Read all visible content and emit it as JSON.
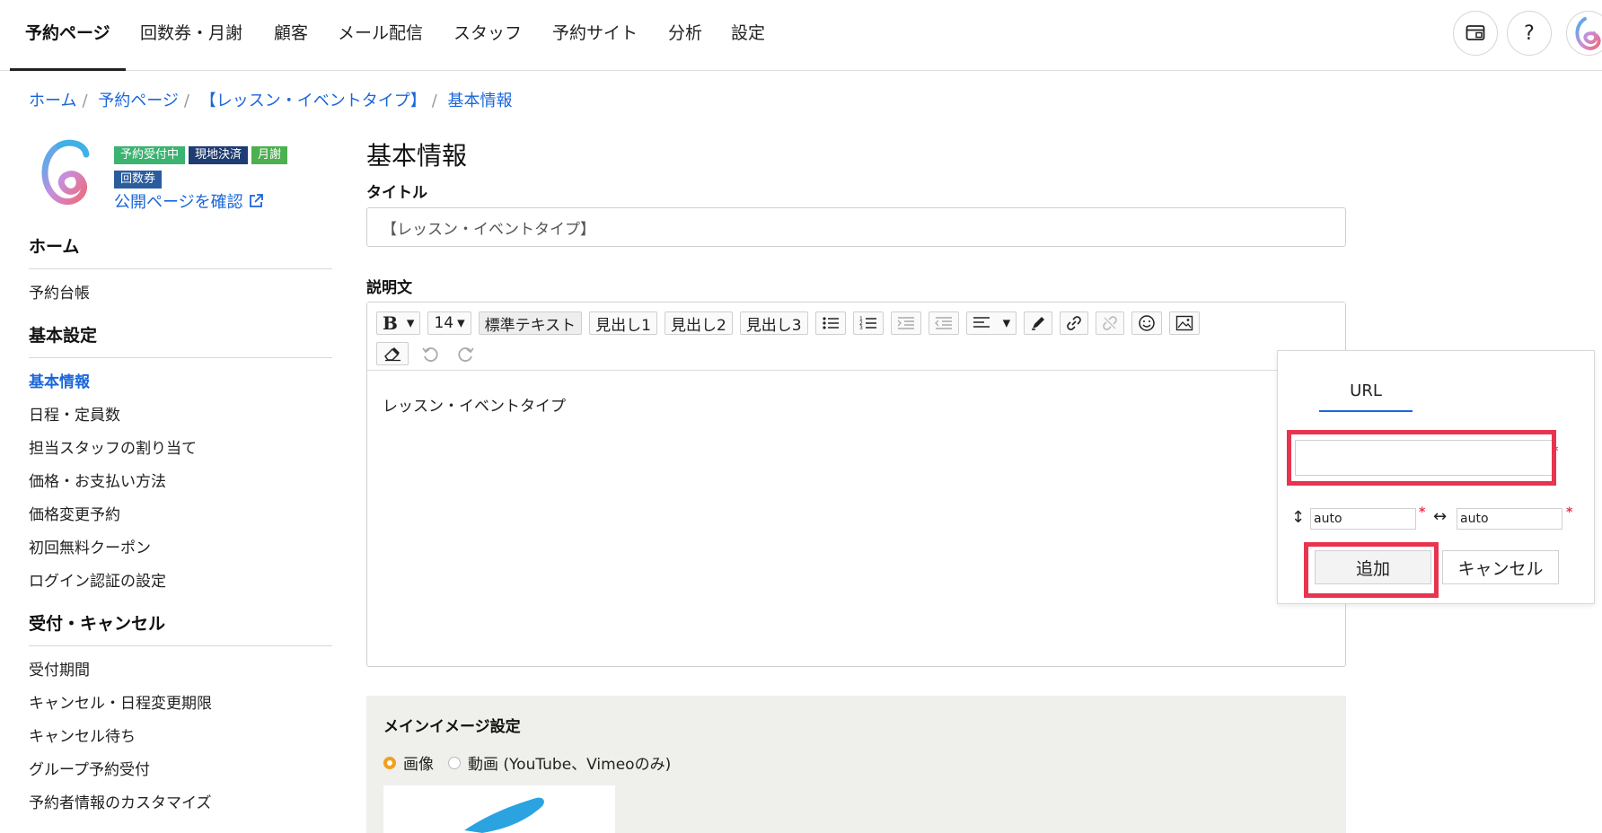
{
  "topnav": {
    "items": [
      {
        "label": "予約ページ",
        "active": true
      },
      {
        "label": "回数券・月謝"
      },
      {
        "label": "顧客"
      },
      {
        "label": "メール配信"
      },
      {
        "label": "スタッフ"
      },
      {
        "label": "予約サイト"
      },
      {
        "label": "分析"
      },
      {
        "label": "設定"
      }
    ],
    "help_label": "?"
  },
  "breadcrumb": [
    "ホーム",
    "予約ページ",
    "【レッスン・イベントタイプ】",
    "基本情報"
  ],
  "sidebar": {
    "badges": [
      "予約受付中",
      "現地決済",
      "月謝",
      "回数券"
    ],
    "public_link": "公開ページを確認",
    "groups": [
      {
        "title": "ホーム",
        "items": [
          "予約台帳"
        ]
      },
      {
        "title": "基本設定",
        "items": [
          "基本情報",
          "日程・定員数",
          "担当スタッフの割り当て",
          "価格・お支払い方法",
          "価格変更予約",
          "初回無料クーポン",
          "ログイン認証の設定"
        ],
        "active": "基本情報"
      },
      {
        "title": "受付・キャンセル",
        "items": [
          "受付期間",
          "キャンセル・日程変更期限",
          "キャンセル待ち",
          "グループ予約受付",
          "予約者情報のカスタマイズ"
        ]
      }
    ]
  },
  "main": {
    "page_title": "基本情報",
    "title_label": "タイトル",
    "title_value": "【レッスン・イベントタイプ】",
    "description_label": "説明文",
    "toolbar": {
      "bold": "B",
      "font_size": "14",
      "normal_text": "標準テキスト",
      "h1": "見出し1",
      "h2": "見出し2",
      "h3": "見出し3"
    },
    "editor_text": "レッスン・イベントタイプ",
    "image_section_title": "メインイメージ設定",
    "radio_image": "画像",
    "radio_video": "動画 (YouTube、Vimeoのみ)"
  },
  "image_popover": {
    "tab_label": "URL",
    "url_value": "",
    "height_value": "auto",
    "width_value": "auto",
    "required_mark": "*",
    "add_label": "追加",
    "cancel_label": "キャンセル"
  },
  "colors": {
    "accent": "#1a66d9",
    "highlight": "#e8344f",
    "badge_green": "#3cb371",
    "badge_navy": "#1f3d72",
    "radio_selected": "#f0a020"
  }
}
